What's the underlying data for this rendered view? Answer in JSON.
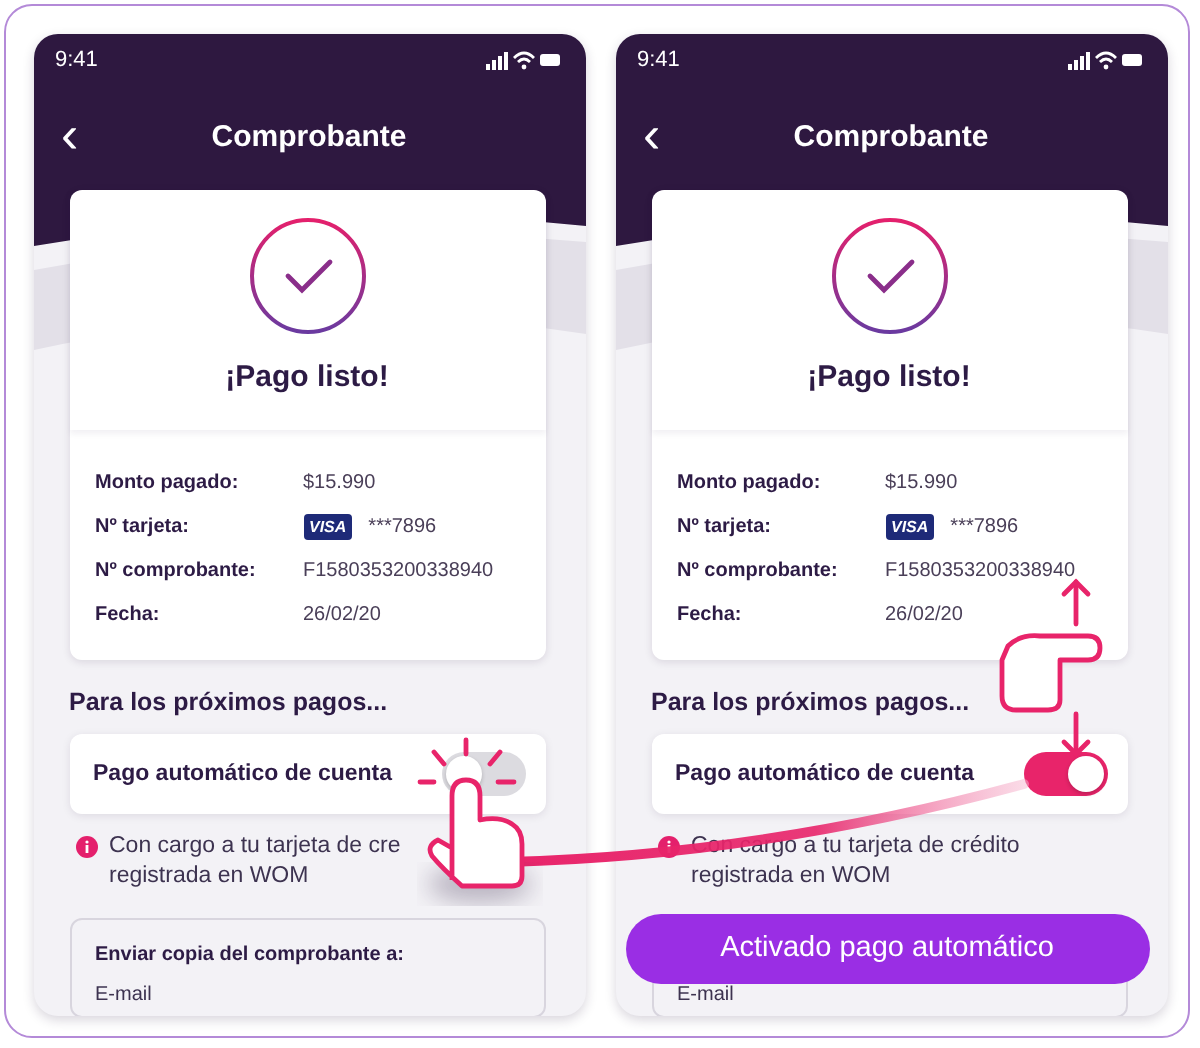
{
  "screens": [
    {
      "status_time": "9:41",
      "title": "Comprobante",
      "back": "‹",
      "headline": "¡Pago listo!",
      "details": [
        {
          "label": "Monto pagado:",
          "value": "$15.990"
        },
        {
          "label": "Nº tarjeta:",
          "brand": "VISA",
          "value": "***7896"
        },
        {
          "label": "Nº comprobante:",
          "value": "F1580353200338940"
        },
        {
          "label": "Fecha:",
          "value": "26/02/20"
        }
      ],
      "section_title": "Para los próximos pagos...",
      "toggle": {
        "label": "Pago automático de cuenta",
        "on": false
      },
      "note": [
        "Con cargo a tu tarjeta de cre",
        "registrada en WOM"
      ],
      "email_card": {
        "title": "Enviar copia del comprobante a:",
        "field": "E-mail"
      }
    },
    {
      "status_time": "9:41",
      "title": "Comprobante",
      "back": "‹",
      "headline": "¡Pago listo!",
      "details": [
        {
          "label": "Monto pagado:",
          "value": "$15.990"
        },
        {
          "label": "Nº tarjeta:",
          "brand": "VISA",
          "value": "***7896"
        },
        {
          "label": "Nº comprobante:",
          "value": "F1580353200338940"
        },
        {
          "label": "Fecha:",
          "value": "26/02/20"
        }
      ],
      "section_title": "Para los próximos pagos...",
      "toggle": {
        "label": "Pago automático de cuenta",
        "on": true
      },
      "note": [
        "Con cargo a tu tarjeta de crédito",
        "registrada en WOM"
      ],
      "email_card": {
        "field": "E-mail"
      },
      "button": "Activado pago automático"
    }
  ]
}
